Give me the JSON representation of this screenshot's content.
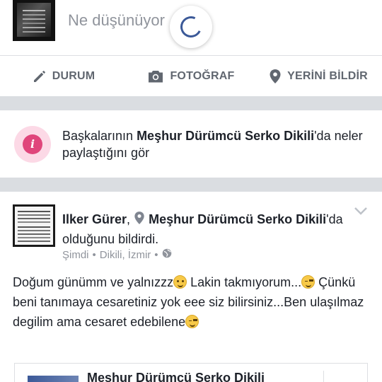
{
  "composer": {
    "placeholder": "Ne düşünüyor",
    "actions": [
      {
        "label": "DURUM",
        "icon": "pencil-icon"
      },
      {
        "label": "FOTOĞRAF",
        "icon": "camera-icon"
      },
      {
        "label": "YERİNİ BİLDİR",
        "icon": "location-pin-icon"
      }
    ]
  },
  "suggestion": {
    "prefix": "Başkalarının ",
    "place": "Meşhur Dürümcü Serko Dikili",
    "suffix": "'da neler paylaştığını gör",
    "icon": "info-icon"
  },
  "post": {
    "author": "Ilker Gürer",
    "comma": ", ",
    "place": "Meşhur Dürümcü Serko Dikili",
    "checkin_suffix": "'da olduğunu bildirdi.",
    "time": "Şimdi",
    "location": "Dikili, İzmir",
    "dot": "•",
    "body": {
      "line1a": "Doğum günümm ve yalnızzz",
      "line1b": " Lakin takmıyorum...",
      "line2": "Çünkü beni tanımaya cesaretiniz yok eee siz bilirsiniz...Ben ulaşılmaz degilim ama cesaret edebilene"
    },
    "shared_title": "Meşhur Dürümcü Serko Dikili"
  },
  "colors": {
    "brand": "#3b5998",
    "info_pink": "#e0457b",
    "text": "#1d2129",
    "muted": "#90949c"
  }
}
